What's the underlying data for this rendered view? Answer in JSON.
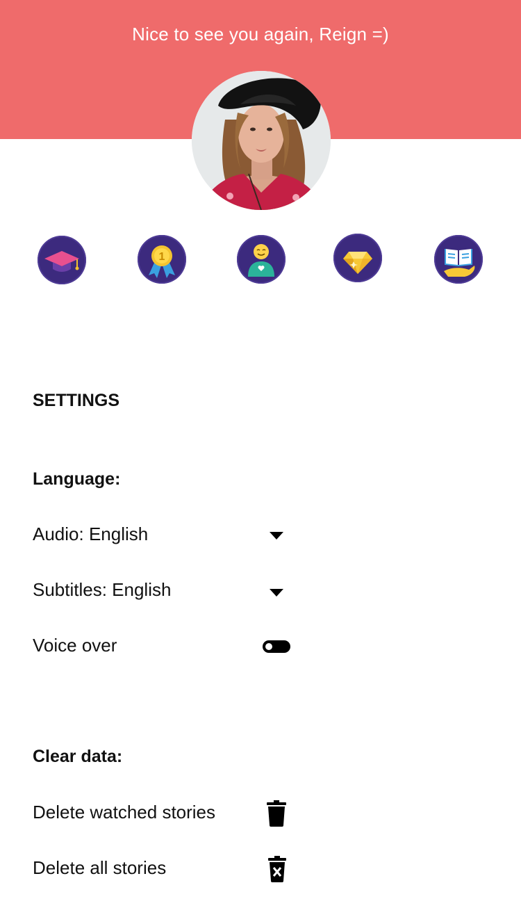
{
  "header": {
    "greeting": "Nice to see you again, Reign =)",
    "background_color": "#ef6b6b"
  },
  "profile": {
    "avatar": "profile-photo"
  },
  "badges": [
    {
      "icon": "graduation-cap-icon"
    },
    {
      "icon": "first-place-medal-icon"
    },
    {
      "icon": "happy-person-heart-icon"
    },
    {
      "icon": "diamond-icon"
    },
    {
      "icon": "open-book-hand-icon"
    }
  ],
  "settings": {
    "title": "SETTINGS",
    "language": {
      "heading": "Language:",
      "audio_label": "Audio: English",
      "subtitles_label": "Subtitles: English",
      "voice_over_label": "Voice over",
      "voice_over_enabled": false
    },
    "clear_data": {
      "heading": "Clear data:",
      "delete_watched_label": "Delete watched stories",
      "delete_all_label": "Delete all stories"
    }
  }
}
